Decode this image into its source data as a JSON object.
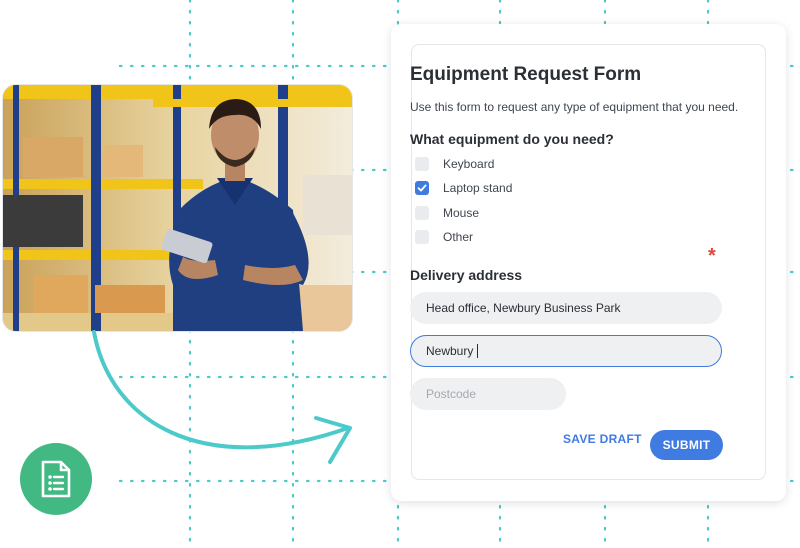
{
  "form": {
    "title": "Equipment Request Form",
    "description": "Use this form to request any type of equipment that you need.",
    "equipment_question": "What equipment do you need?",
    "options": [
      {
        "label": "Keyboard",
        "checked": false
      },
      {
        "label": "Laptop stand",
        "checked": true
      },
      {
        "label": "Mouse",
        "checked": false
      },
      {
        "label": "Other",
        "checked": false
      }
    ],
    "delivery_label": "Delivery address",
    "required_mark": "*",
    "address_line_value": "Head office, Newbury Business Park",
    "city_value": "Newbury",
    "postcode_placeholder": "Postcode",
    "save_draft_label": "SAVE DRAFT",
    "submit_label": "SUBMIT"
  },
  "colors": {
    "accent": "#3f7be0",
    "required": "#e0453f",
    "teal_arrow": "#4cc9c9",
    "badge_green": "#42b883"
  },
  "icons": {
    "badge": "document-list-icon",
    "arrow": "curved-arrow-icon",
    "checkmark": "checkmark-icon"
  },
  "photo": {
    "subject": "warehouse-worker-photo"
  }
}
